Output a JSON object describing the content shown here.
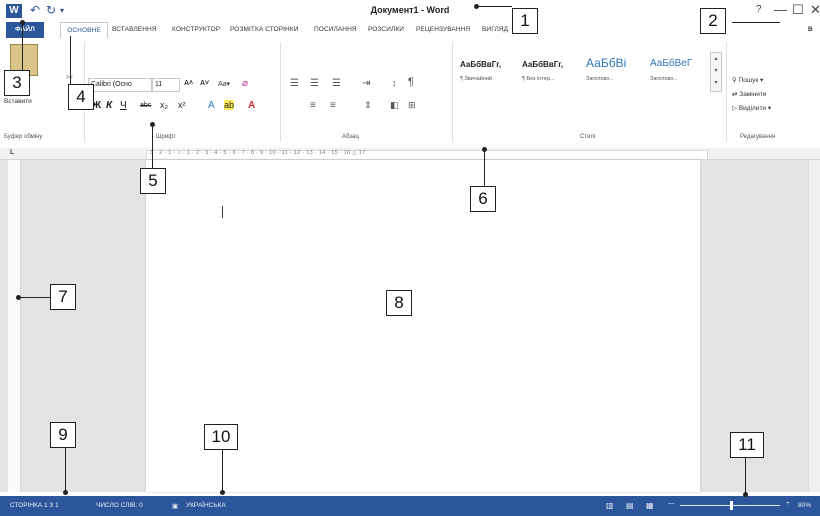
{
  "titlebar": {
    "app_icon_letter": "W",
    "undo_icon": "↶",
    "redo_icon": "↻",
    "customize_icon": "▾",
    "doc_title": "Документ1 - Word",
    "help_icon": "?",
    "minimize_icon": "—",
    "restore_icon": "☐",
    "close_icon": "✕"
  },
  "tabs": [
    {
      "label": "ФАЙЛ"
    },
    {
      "label": "ОСНОВНЕ"
    },
    {
      "label": "ВСТАВЛЕННЯ"
    },
    {
      "label": "КОНСТРУКТОР"
    },
    {
      "label": "РОЗМІТКА СТОРІНКИ"
    },
    {
      "label": "ПОСИЛАННЯ"
    },
    {
      "label": "РОЗСИЛКИ"
    },
    {
      "label": "РЕЦЕНЗУВАННЯ"
    },
    {
      "label": "ВИГЛЯД"
    }
  ],
  "account_letter": "В",
  "ribbon": {
    "paste_label": "Вставити",
    "clipboard_group": "Буфер обміну",
    "font_name": "Calibri (Осно",
    "font_size": "11",
    "font_grow": "A˄",
    "font_shrink": "A˅",
    "change_case": "Aa▾",
    "bold": "Ж",
    "italic": "К",
    "underline": "Ч",
    "strike": "abc",
    "subscript": "x₂",
    "superscript": "x²",
    "font_group": "Шрифт",
    "paragraph_group": "Абзац",
    "pilcrow": "¶",
    "styles": [
      {
        "sample": "АаБбВвГг,",
        "name": "¶ Звичайний"
      },
      {
        "sample": "АаБбВвГг,",
        "name": "¶ Без інтер..."
      },
      {
        "sample": "АаБбВі",
        "name": "Заголово..."
      },
      {
        "sample": "АаБбВеГ",
        "name": "Заголово..."
      }
    ],
    "styles_group": "Стилі",
    "find": "Пошук ▾",
    "replace": "Замінити",
    "select": "Виділити ▾",
    "editing_group": "Редагування"
  },
  "ruler": {
    "ticks": "3 · 2 · 1 · ⌂ · 1 · 2 · 3 · 4 · 5 · 6 · 7 · 8 · 9 · 10 · 11 · 12 · 13 · 14 · 15 · 16 △ 17",
    "corner": "L"
  },
  "document": {
    "cursor": "I"
  },
  "statusbar": {
    "page": "СТОРІНКА 1 З 1",
    "words": "ЧИСЛО СЛІВ: 0",
    "language": "УКРАЇНСЬКА",
    "zoom_minus": "—",
    "zoom_plus": "+",
    "zoom": "80%"
  },
  "callouts": [
    "1",
    "2",
    "3",
    "4",
    "5",
    "6",
    "7",
    "8",
    "9",
    "10",
    "11"
  ]
}
